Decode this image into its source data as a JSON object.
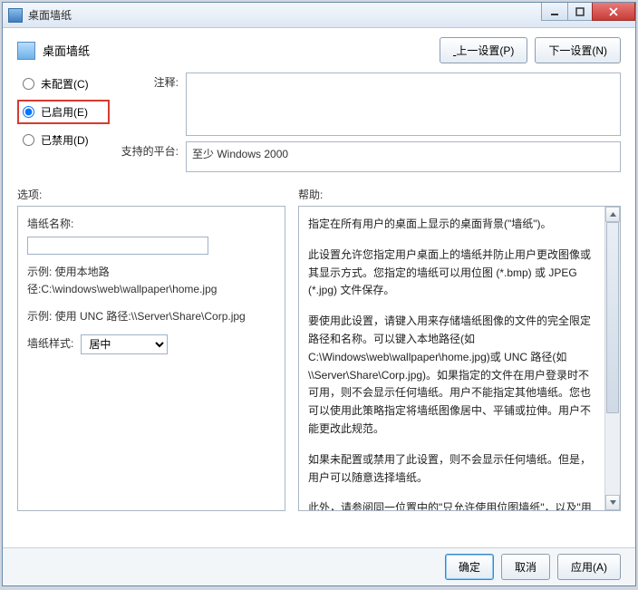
{
  "window": {
    "title": "桌面墙纸"
  },
  "header": {
    "title": "桌面墙纸",
    "prev_btn": "上一设置(P)",
    "next_btn": "下一设置(N)"
  },
  "radios": {
    "not_configured": "未配置(C)",
    "enabled": "已启用(E)",
    "disabled": "已禁用(D)"
  },
  "fields": {
    "comment_label": "注释:",
    "comment_value": "",
    "platform_label": "支持的平台:",
    "platform_value": "至少 Windows 2000"
  },
  "options": {
    "label": "选项:",
    "name_label": "墙纸名称:",
    "name_value": "",
    "example1": "示例: 使用本地路",
    "example1b": "径:C:\\windows\\web\\wallpaper\\home.jpg",
    "example2": "示例: 使用 UNC 路径:\\\\Server\\Share\\Corp.jpg",
    "style_label": "墙纸样式:",
    "style_value": "居中"
  },
  "help": {
    "label": "帮助:",
    "p1": "指定在所有用户的桌面上显示的桌面背景(\"墙纸\")。",
    "p2": "此设置允许您指定用户桌面上的墙纸并防止用户更改图像或其显示方式。您指定的墙纸可以用位图 (*.bmp) 或 JPEG (*.jpg) 文件保存。",
    "p3": "要使用此设置，请键入用来存储墙纸图像的文件的完全限定路径和名称。可以键入本地路径(如 C:\\Windows\\web\\wallpaper\\home.jpg)或 UNC 路径(如 \\\\Server\\Share\\Corp.jpg)。如果指定的文件在用户登录时不可用，则不会显示任何墙纸。用户不能指定其他墙纸。您也可以使用此策略指定将墙纸图像居中、平铺或拉伸。用户不能更改此规范。",
    "p4": "如果未配置或禁用了此设置，则不会显示任何墙纸。但是，用户可以随意选择墙纸。",
    "p5": "此外，请参阅同一位置中的\"只允许使用位图墙纸\"，以及\"用户配置\\管理模板\\控制面板\"中的\"阻止更改墙纸\"设置。"
  },
  "buttons": {
    "ok": "确定",
    "cancel": "取消",
    "apply": "应用(A)"
  }
}
